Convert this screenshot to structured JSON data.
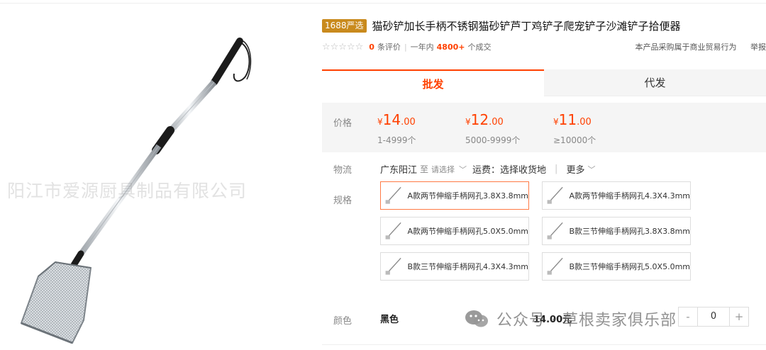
{
  "image": {
    "watermark": "阳江市爱源厨具制品有限公司"
  },
  "product": {
    "badge": "1688严选",
    "title": "猫砂铲加长手柄不锈钢猫砂铲芦丁鸡铲子爬宠铲子沙滩铲子拾便器"
  },
  "rating": {
    "stars_icon": "star-outline-icon",
    "review_count": "0",
    "review_label": "条评价",
    "period_label": "一年内",
    "deal_count": "4800+",
    "deal_label": "个成交",
    "trade_note": "本产品采购属于商业贸易行为",
    "report": "举报"
  },
  "tabs": [
    {
      "label": "批发",
      "active": true
    },
    {
      "label": "代发",
      "active": false
    }
  ],
  "pricing": {
    "label": "价格",
    "currency": "¥",
    "tiers": [
      {
        "int": "14",
        "dec": ".00",
        "range": "1-4999个"
      },
      {
        "int": "12",
        "dec": ".00",
        "range": "5000-9999个"
      },
      {
        "int": "11",
        "dec": ".00",
        "range": "≥10000个"
      }
    ]
  },
  "logistics": {
    "label": "物流",
    "origin": "广东阳江",
    "to": "至",
    "select_hint": "请选择",
    "shipping": "运费：选择收货地",
    "more": "更多"
  },
  "specs": {
    "label": "规格",
    "items": [
      {
        "label": "A款两节伸缩手柄网孔3.8X3.8mm",
        "selected": true
      },
      {
        "label": "A款两节伸缩手柄网孔4.3X4.3mm",
        "selected": false
      },
      {
        "label": "A款两节伸缩手柄网孔5.0X5.0mm",
        "selected": false
      },
      {
        "label": "B款三节伸缩手柄网孔3.8X3.8mm",
        "selected": false
      },
      {
        "label": "B款三节伸缩手柄网孔4.3X4.3mm",
        "selected": false
      },
      {
        "label": "B款三节伸缩手柄网孔5.0X5.0mm",
        "selected": false
      }
    ]
  },
  "color": {
    "label": "颜色",
    "name": "黑色",
    "price": "14.00元",
    "quantity": "0",
    "minus": "-",
    "plus": "+"
  },
  "overlay": {
    "wechat_text": "公众号 · 草根卖家俱乐部"
  },
  "colors": {
    "accent": "#ff4000",
    "badge": "#c98a1d"
  }
}
